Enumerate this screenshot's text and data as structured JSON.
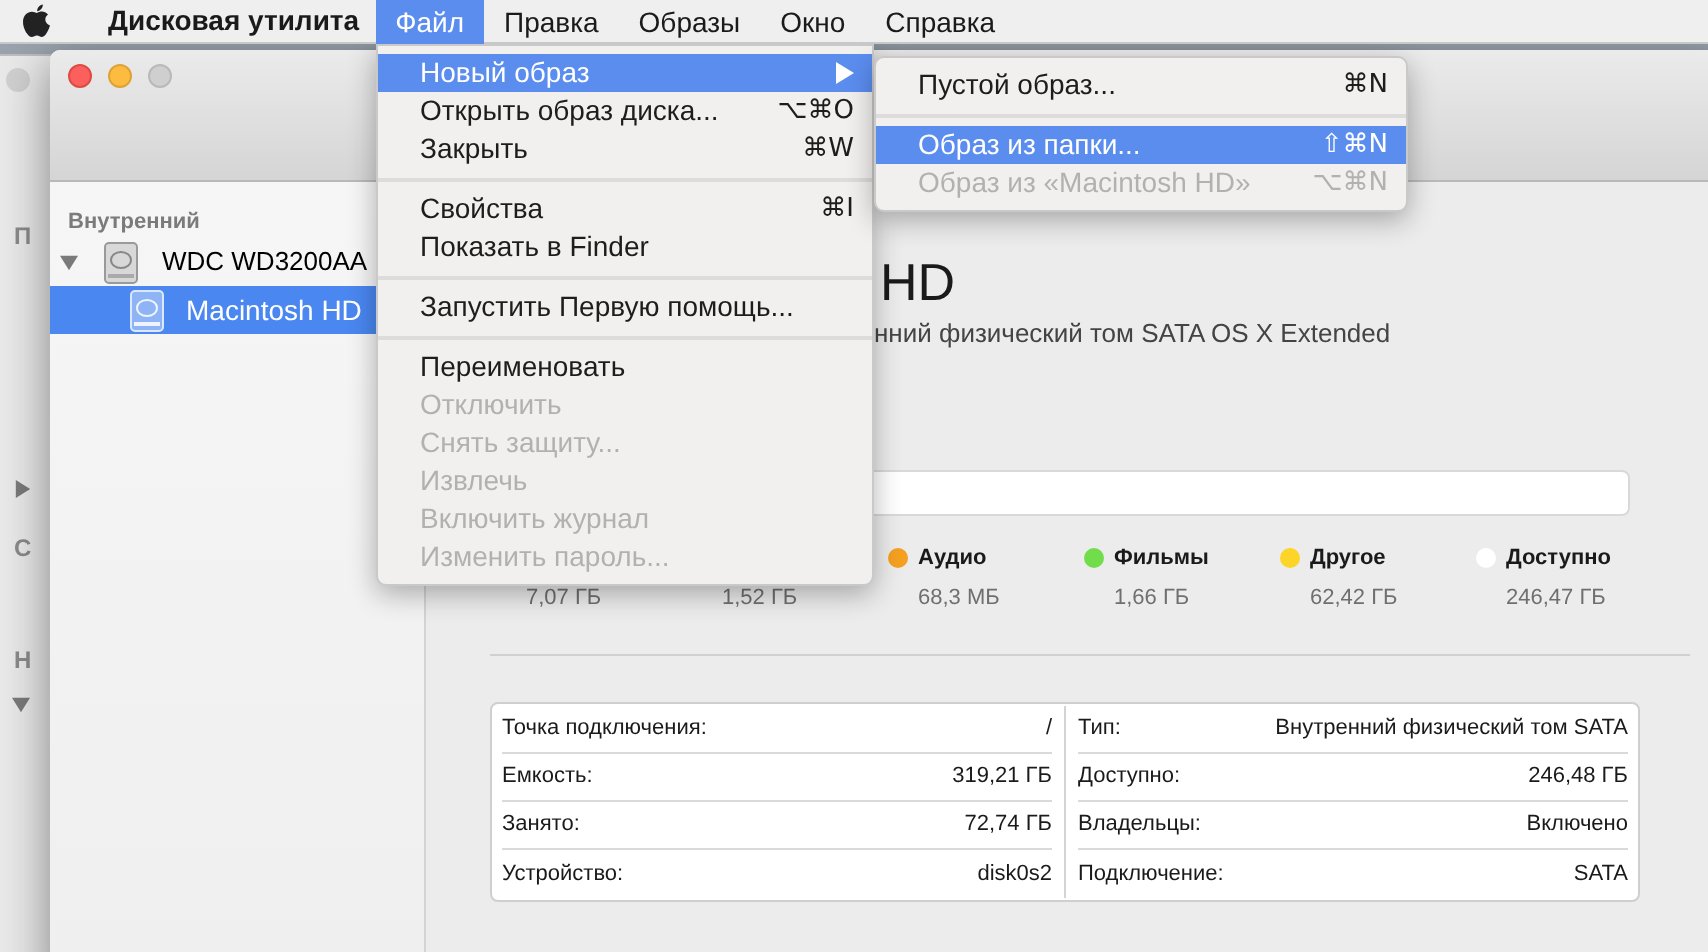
{
  "menu_bar": {
    "app_name": "Дисковая утилита",
    "items": [
      {
        "label": "Файл",
        "selected": true
      },
      {
        "label": "Правка",
        "selected": false
      },
      {
        "label": "Образы",
        "selected": false
      },
      {
        "label": "Окно",
        "selected": false
      },
      {
        "label": "Справка",
        "selected": false
      }
    ]
  },
  "background_window": {
    "sidebar_texts": [
      "П",
      "С",
      "Н"
    ]
  },
  "sidebar": {
    "heading": "Внутренний",
    "disks": [
      {
        "label": "WDC WD3200AA",
        "expanded": true,
        "selected": false,
        "children": [
          {
            "label": "Macintosh HD",
            "selected": true
          }
        ]
      }
    ]
  },
  "volume": {
    "title": "HD",
    "subtitle": "нний физический том SATA OS X Extended"
  },
  "legend": [
    {
      "value": "7,07 ГБ"
    },
    {
      "value": "1,52 ГБ"
    },
    {
      "label": "Аудио",
      "color": "#f5a021",
      "value": "68,3 МБ"
    },
    {
      "label": "Фильмы",
      "color": "#72dd4a",
      "value": "1,66 ГБ"
    },
    {
      "label": "Другое",
      "color": "#fdd428",
      "value": "62,42 ГБ"
    },
    {
      "label": "Доступно",
      "color": "#ffffff",
      "value": "246,47 ГБ"
    }
  ],
  "info_table": {
    "rows": [
      [
        {
          "label": "Точка подключения:",
          "value": "/"
        },
        {
          "label": "Тип:",
          "value": "Внутренний физический том SATA"
        }
      ],
      [
        {
          "label": "Емкость:",
          "value": "319,21 ГБ"
        },
        {
          "label": "Доступно:",
          "value": "246,48 ГБ"
        }
      ],
      [
        {
          "label": "Занято:",
          "value": "72,74 ГБ"
        },
        {
          "label": "Владельцы:",
          "value": "Включено"
        }
      ],
      [
        {
          "label": "Устройство:",
          "value": "disk0s2"
        },
        {
          "label": "Подключение:",
          "value": "SATA"
        }
      ]
    ]
  },
  "file_menu": {
    "items": [
      {
        "kind": "item",
        "label": "Новый образ",
        "has_submenu": true,
        "selected": true,
        "disabled": false
      },
      {
        "kind": "item",
        "label": "Открыть образ диска...",
        "shortcut": "⌥⌘O",
        "selected": false,
        "disabled": false
      },
      {
        "kind": "item",
        "label": "Закрыть",
        "shortcut": "⌘W",
        "selected": false,
        "disabled": false
      },
      {
        "kind": "separator"
      },
      {
        "kind": "item",
        "label": "Свойства",
        "shortcut": "⌘I",
        "selected": false,
        "disabled": false
      },
      {
        "kind": "item",
        "label": "Показать в Finder",
        "selected": false,
        "disabled": false
      },
      {
        "kind": "separator"
      },
      {
        "kind": "item",
        "label": "Запустить Первую помощь...",
        "selected": false,
        "disabled": false
      },
      {
        "kind": "separator"
      },
      {
        "kind": "item",
        "label": "Переименовать",
        "selected": false,
        "disabled": false
      },
      {
        "kind": "item",
        "label": "Отключить",
        "selected": false,
        "disabled": true
      },
      {
        "kind": "item",
        "label": "Снять защиту...",
        "selected": false,
        "disabled": true
      },
      {
        "kind": "item",
        "label": "Извлечь",
        "selected": false,
        "disabled": true
      },
      {
        "kind": "item",
        "label": "Включить журнал",
        "selected": false,
        "disabled": true
      },
      {
        "kind": "item",
        "label": "Изменить пароль...",
        "selected": false,
        "disabled": true
      }
    ]
  },
  "new_image_submenu": {
    "items": [
      {
        "kind": "item",
        "label": "Пустой образ...",
        "shortcut": "⌘N",
        "selected": false,
        "disabled": false
      },
      {
        "kind": "separator"
      },
      {
        "kind": "item",
        "label": "Образ из папки...",
        "shortcut": "⇧⌘N",
        "selected": true,
        "disabled": false
      },
      {
        "kind": "item",
        "label": "Образ из «Macintosh HD»",
        "shortcut": "⌥⌘N",
        "selected": false,
        "disabled": true
      }
    ]
  }
}
